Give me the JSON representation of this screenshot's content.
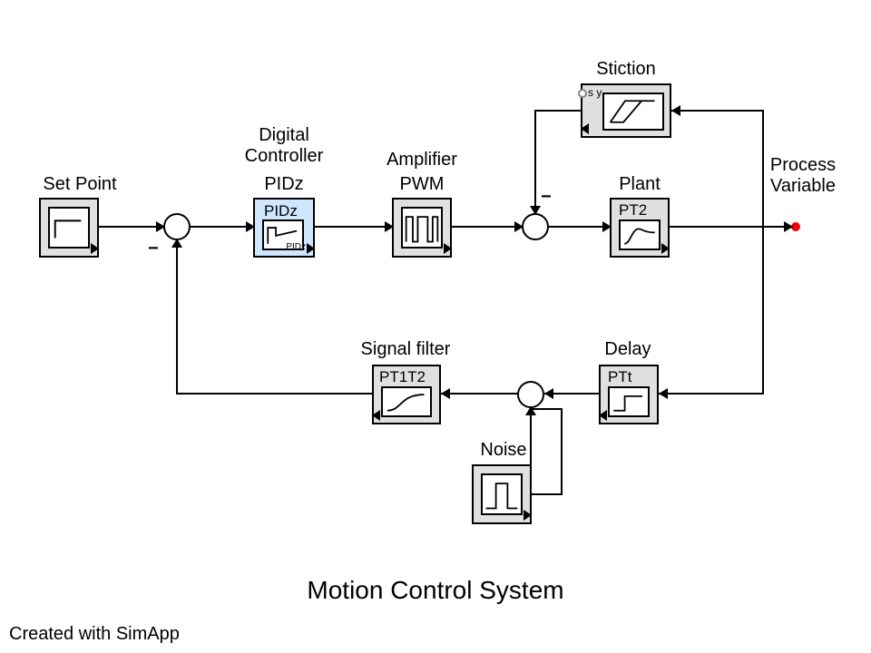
{
  "labels": {
    "set_point": "Set Point",
    "digital_controller": "Digital\nController",
    "pidz": "PIDz",
    "amplifier": "Amplifier",
    "pwm": "PWM",
    "stiction": "Stiction",
    "plant": "Plant",
    "process_variable": "Process\nVariable",
    "signal_filter": "Signal filter",
    "delay": "Delay",
    "noise": "Noise"
  },
  "block_tags": {
    "pidz_inner": "PIDz",
    "plant_inner": "PT2",
    "filter_inner": "PT1T2",
    "delay_inner": "PTt",
    "stiction_sy": "s\ny"
  },
  "caption": "Motion Control System",
  "credit": "Created with SimApp",
  "colors": {
    "selected_fill": "#cfe6ff",
    "block_fill": "#e0e0e0",
    "accent_red": "#e00"
  }
}
